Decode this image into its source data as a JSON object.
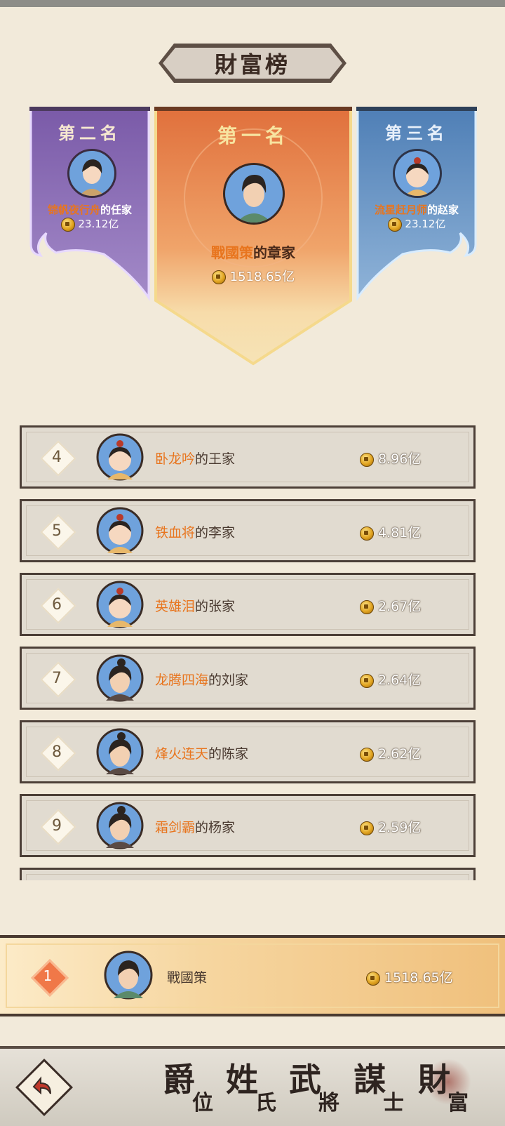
{
  "page_title": "財富榜",
  "podium": {
    "first": {
      "rank_label": "第一名",
      "name_highlight": "戰國策",
      "name_suffix": "的章家",
      "wealth": "1518.65亿"
    },
    "second": {
      "rank_label": "第二名",
      "name_highlight": "锦帆夜行舟",
      "name_suffix": "的任家",
      "wealth": "23.12亿"
    },
    "third": {
      "rank_label": "第三名",
      "name_highlight": "流星赶月师",
      "name_suffix": "的赵家",
      "wealth": "23.12亿"
    }
  },
  "ranking": [
    {
      "rank": "4",
      "name_highlight": "卧龙吟",
      "name_suffix": "的王家",
      "wealth": "8.96亿",
      "avatar": "child"
    },
    {
      "rank": "5",
      "name_highlight": "铁血将",
      "name_suffix": "的李家",
      "wealth": "4.81亿",
      "avatar": "child"
    },
    {
      "rank": "6",
      "name_highlight": "英雄泪",
      "name_suffix": "的张家",
      "wealth": "2.67亿",
      "avatar": "child"
    },
    {
      "rank": "7",
      "name_highlight": "龙腾四海",
      "name_suffix": "的刘家",
      "wealth": "2.64亿",
      "avatar": "adult"
    },
    {
      "rank": "8",
      "name_highlight": "烽火连天",
      "name_suffix": "的陈家",
      "wealth": "2.62亿",
      "avatar": "adult"
    },
    {
      "rank": "9",
      "name_highlight": "霜剑霸",
      "name_suffix": "的杨家",
      "wealth": "2.59亿",
      "avatar": "adult"
    }
  ],
  "my_rank": {
    "rank": "1",
    "name": "戰國策",
    "wealth": "1518.65亿"
  },
  "nav": [
    {
      "big": "爵",
      "small": "位"
    },
    {
      "big": "姓",
      "small": "氏"
    },
    {
      "big": "武",
      "small": "將"
    },
    {
      "big": "謀",
      "small": "士"
    },
    {
      "big": "財",
      "small": "富",
      "selected": true
    }
  ],
  "colors": {
    "highlight": "#e8751e",
    "first_banner": "#e98a4e",
    "second_banner": "#8a67b6",
    "third_banner": "#5d8cc0"
  }
}
